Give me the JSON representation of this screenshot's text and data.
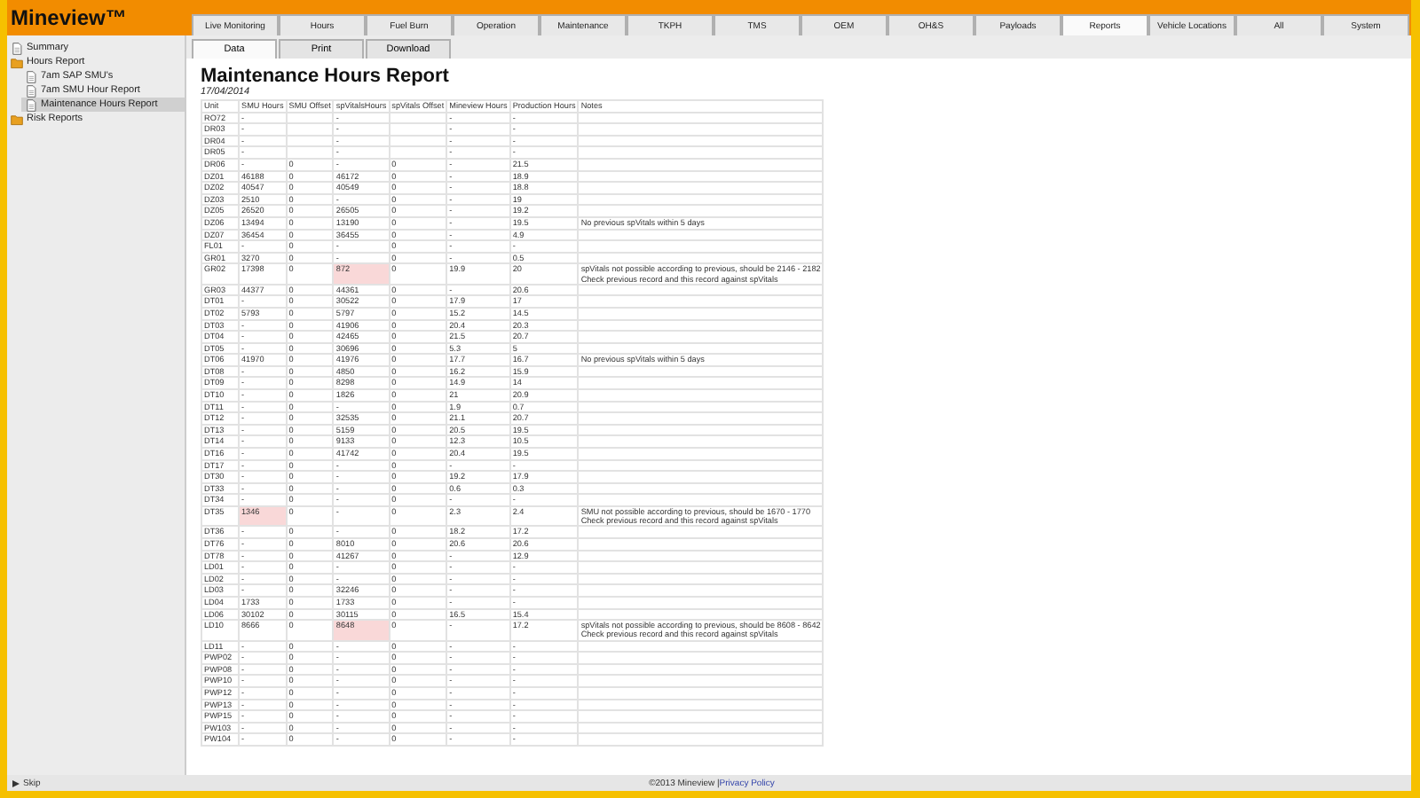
{
  "app": {
    "title": "Mineview™"
  },
  "nav_tabs": [
    {
      "label": "Live Monitoring",
      "selected": false
    },
    {
      "label": "Hours",
      "selected": false
    },
    {
      "label": "Fuel Burn",
      "selected": false
    },
    {
      "label": "Operation",
      "selected": false
    },
    {
      "label": "Maintenance",
      "selected": false
    },
    {
      "label": "TKPH",
      "selected": false
    },
    {
      "label": "TMS",
      "selected": false
    },
    {
      "label": "OEM",
      "selected": false
    },
    {
      "label": "OH&S",
      "selected": false
    },
    {
      "label": "Payloads",
      "selected": false
    },
    {
      "label": "Reports",
      "selected": true
    },
    {
      "label": "Vehicle Locations",
      "selected": false
    },
    {
      "label": "All",
      "selected": false
    },
    {
      "label": "System",
      "selected": false
    }
  ],
  "sub_tabs": [
    {
      "label": "Data",
      "selected": true
    },
    {
      "label": "Print",
      "selected": false
    },
    {
      "label": "Download",
      "selected": false
    }
  ],
  "sidebar": {
    "items": [
      {
        "label": "Summary",
        "kind": "document",
        "selected": false
      },
      {
        "label": "Hours Report",
        "kind": "folder",
        "selected": false,
        "expanded": true,
        "children": [
          {
            "label": "7am SAP SMU's",
            "kind": "document",
            "selected": false
          },
          {
            "label": "7am SMU Hour Report",
            "kind": "document",
            "selected": false
          },
          {
            "label": "Maintenance Hours Report",
            "kind": "document",
            "selected": true
          }
        ]
      },
      {
        "label": "Risk Reports",
        "kind": "folder",
        "selected": false,
        "expanded": false
      }
    ]
  },
  "report": {
    "title": "Maintenance Hours Report",
    "date": "17/04/2014",
    "table": {
      "columns": [
        "Unit",
        "SMU Hours",
        "SMU Offset",
        "spVitalsHours",
        "spVitals Offset",
        "Mineview Hours",
        "Production Hours",
        "Notes"
      ],
      "rows": [
        {
          "cells": [
            "RO72",
            "-",
            null,
            "-",
            null,
            "-",
            "-",
            null
          ]
        },
        {
          "cells": [
            "DR03",
            "-",
            null,
            "-",
            null,
            "-",
            "-",
            null
          ]
        },
        {
          "cells": [
            "DR04",
            "-",
            null,
            "-",
            null,
            "-",
            "-",
            null
          ]
        },
        {
          "cells": [
            "DR05",
            "-",
            null,
            "-",
            null,
            "-",
            "-",
            null
          ]
        },
        {
          "cells": [
            "DR06",
            "-",
            "0",
            "-",
            "0",
            "-",
            "21.5",
            null
          ]
        },
        {
          "cells": [
            "DZ01",
            "46188",
            "0",
            "46172",
            "0",
            "-",
            "18.9",
            null
          ]
        },
        {
          "cells": [
            "DZ02",
            "40547",
            "0",
            "40549",
            "0",
            "-",
            "18.8",
            null
          ]
        },
        {
          "cells": [
            "DZ03",
            "2510",
            "0",
            "-",
            "0",
            "-",
            "19",
            null
          ]
        },
        {
          "cells": [
            "DZ05",
            "26520",
            "0",
            "26505",
            "0",
            "-",
            "19.2",
            null
          ]
        },
        {
          "cells": [
            "DZ06",
            "13494",
            "0",
            "13190",
            "0",
            "-",
            "19.5",
            "No previous spVitals within 5 days"
          ]
        },
        {
          "cells": [
            "DZ07",
            "36454",
            "0",
            "36455",
            "0",
            "-",
            "4.9",
            null
          ]
        },
        {
          "cells": [
            "FL01",
            "-",
            "0",
            "-",
            "0",
            "-",
            "-",
            null
          ]
        },
        {
          "cells": [
            "GR01",
            "3270",
            "0",
            "-",
            "0",
            "-",
            "0.5",
            null
          ]
        },
        {
          "cells": [
            "GR02",
            "17398",
            "0",
            {
              "text": "872",
              "flagged": true
            },
            "0",
            "19.9",
            "20",
            "spVitals not possible according to previous, should be 2146 - 2182\nCheck previous record and this record against spVitals"
          ]
        },
        {
          "cells": [
            "GR03",
            "44377",
            "0",
            "44361",
            "0",
            "-",
            "20.6",
            null
          ]
        },
        {
          "cells": [
            "DT01",
            "-",
            "0",
            "30522",
            "0",
            "17.9",
            "17",
            null
          ]
        },
        {
          "cells": [
            "DT02",
            "5793",
            "0",
            "5797",
            "0",
            "15.2",
            "14.5",
            null
          ]
        },
        {
          "cells": [
            "DT03",
            "-",
            "0",
            "41906",
            "0",
            "20.4",
            "20.3",
            null
          ]
        },
        {
          "cells": [
            "DT04",
            "-",
            "0",
            "42465",
            "0",
            "21.5",
            "20.7",
            null
          ]
        },
        {
          "cells": [
            "DT05",
            "-",
            "0",
            "30696",
            "0",
            "5.3",
            "5",
            null
          ]
        },
        {
          "cells": [
            "DT06",
            "41970",
            "0",
            "41976",
            "0",
            "17.7",
            "16.7",
            "No previous spVitals within 5 days"
          ]
        },
        {
          "cells": [
            "DT08",
            "-",
            "0",
            "4850",
            "0",
            "16.2",
            "15.9",
            null
          ]
        },
        {
          "cells": [
            "DT09",
            "-",
            "0",
            "8298",
            "0",
            "14.9",
            "14",
            null
          ]
        },
        {
          "cells": [
            "DT10",
            "-",
            "0",
            "1826",
            "0",
            "21",
            "20.9",
            null
          ]
        },
        {
          "cells": [
            "DT11",
            "-",
            "0",
            "-",
            "0",
            "1.9",
            "0.7",
            null
          ]
        },
        {
          "cells": [
            "DT12",
            "-",
            "0",
            "32535",
            "0",
            "21.1",
            "20.7",
            null
          ]
        },
        {
          "cells": [
            "DT13",
            "-",
            "0",
            "5159",
            "0",
            "20.5",
            "19.5",
            null
          ]
        },
        {
          "cells": [
            "DT14",
            "-",
            "0",
            "9133",
            "0",
            "12.3",
            "10.5",
            null
          ]
        },
        {
          "cells": [
            "DT16",
            "-",
            "0",
            "41742",
            "0",
            "20.4",
            "19.5",
            null
          ]
        },
        {
          "cells": [
            "DT17",
            "-",
            "0",
            "-",
            "0",
            "-",
            "-",
            null
          ]
        },
        {
          "cells": [
            "DT30",
            "-",
            "0",
            "-",
            "0",
            "19.2",
            "17.9",
            null
          ]
        },
        {
          "cells": [
            "DT33",
            "-",
            "0",
            "-",
            "0",
            "0.6",
            "0.3",
            null
          ]
        },
        {
          "cells": [
            "DT34",
            "-",
            "0",
            "-",
            "0",
            "-",
            "-",
            null
          ]
        },
        {
          "cells": [
            "DT35",
            {
              "text": "1346",
              "flagged": true
            },
            "0",
            "-",
            "0",
            "2.3",
            "2.4",
            "SMU not possible according to previous, should be 1670 - 1770\nCheck previous record and this record against spVitals"
          ]
        },
        {
          "cells": [
            "DT36",
            "-",
            "0",
            "-",
            "0",
            "18.2",
            "17.2",
            null
          ]
        },
        {
          "cells": [
            "DT76",
            "-",
            "0",
            "8010",
            "0",
            "20.6",
            "20.6",
            null
          ]
        },
        {
          "cells": [
            "DT78",
            "-",
            "0",
            "41267",
            "0",
            "-",
            "12.9",
            null
          ]
        },
        {
          "cells": [
            "LD01",
            "-",
            "0",
            "-",
            "0",
            "-",
            "-",
            null
          ]
        },
        {
          "cells": [
            "LD02",
            "-",
            "0",
            "-",
            "0",
            "-",
            "-",
            null
          ]
        },
        {
          "cells": [
            "LD03",
            "-",
            "0",
            "32246",
            "0",
            "-",
            "-",
            null
          ]
        },
        {
          "cells": [
            "LD04",
            "1733",
            "0",
            "1733",
            "0",
            "-",
            "-",
            null
          ]
        },
        {
          "cells": [
            "LD06",
            "30102",
            "0",
            "30115",
            "0",
            "16.5",
            "15.4",
            null
          ]
        },
        {
          "cells": [
            "LD10",
            "8666",
            "0",
            {
              "text": "8648",
              "flagged": true
            },
            "0",
            "-",
            "17.2",
            "spVitals not possible according to previous, should be 8608 - 8642\nCheck previous record and this record against spVitals"
          ]
        },
        {
          "cells": [
            "LD11",
            "-",
            "0",
            "-",
            "0",
            "-",
            "-",
            null
          ]
        },
        {
          "cells": [
            "PWP02",
            "-",
            "0",
            "-",
            "0",
            "-",
            "-",
            null
          ]
        },
        {
          "cells": [
            "PWP08",
            "-",
            "0",
            "-",
            "0",
            "-",
            "-",
            null
          ]
        },
        {
          "cells": [
            "PWP10",
            "-",
            "0",
            "-",
            "0",
            "-",
            "-",
            null
          ]
        },
        {
          "cells": [
            "PWP12",
            "-",
            "0",
            "-",
            "0",
            "-",
            "-",
            null
          ]
        },
        {
          "cells": [
            "PWP13",
            "-",
            "0",
            "-",
            "0",
            "-",
            "-",
            null
          ]
        },
        {
          "cells": [
            "PWP15",
            "-",
            "0",
            "-",
            "0",
            "-",
            "-",
            null
          ]
        },
        {
          "cells": [
            "PW103",
            "-",
            "0",
            "-",
            "0",
            "-",
            "-",
            null
          ]
        },
        {
          "cells": [
            "PW104",
            "-",
            "0",
            "-",
            "0",
            "-",
            "-",
            null
          ]
        }
      ]
    }
  },
  "footer": {
    "left": "Skip",
    "copyright": "©2013 Mineview | ",
    "link": "Privacy Policy"
  }
}
